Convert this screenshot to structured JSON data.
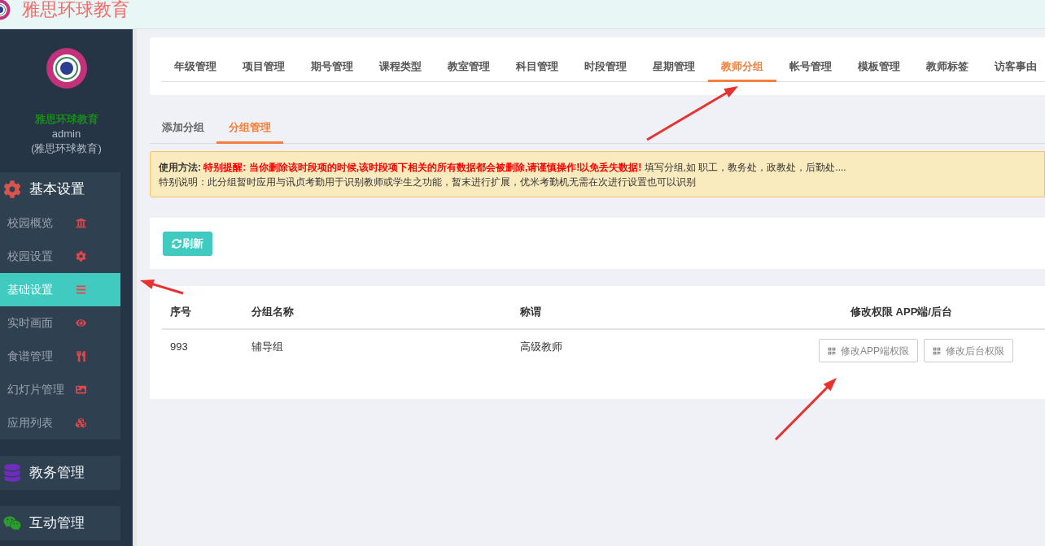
{
  "header": {
    "title": "雅思环球教育"
  },
  "sidebar": {
    "org_name": "雅思环球教育",
    "user": "admin",
    "user_org": "(雅思环球教育)",
    "groups": [
      {
        "label": "基本设置",
        "expanded": true,
        "items": [
          {
            "label": "校园概览",
            "selected": false
          },
          {
            "label": "校园设置",
            "selected": false
          },
          {
            "label": "基础设置",
            "selected": true
          },
          {
            "label": "实时画面",
            "selected": false
          },
          {
            "label": "食谱管理",
            "selected": false
          },
          {
            "label": "幻灯片管理",
            "selected": false
          },
          {
            "label": "应用列表",
            "selected": false
          }
        ]
      },
      {
        "label": "教务管理",
        "expanded": false
      },
      {
        "label": "互动管理",
        "expanded": false
      }
    ]
  },
  "top_tabs": [
    {
      "label": "年级管理",
      "selected": false
    },
    {
      "label": "项目管理",
      "selected": false
    },
    {
      "label": "期号管理",
      "selected": false
    },
    {
      "label": "课程类型",
      "selected": false
    },
    {
      "label": "教室管理",
      "selected": false
    },
    {
      "label": "科目管理",
      "selected": false
    },
    {
      "label": "时段管理",
      "selected": false
    },
    {
      "label": "星期管理",
      "selected": false
    },
    {
      "label": "教师分组",
      "selected": true
    },
    {
      "label": "帐号管理",
      "selected": false
    },
    {
      "label": "模板管理",
      "selected": false
    },
    {
      "label": "教师标签",
      "selected": false
    },
    {
      "label": "访客事由",
      "selected": false
    }
  ],
  "sub_tabs": [
    {
      "label": "添加分组",
      "selected": false
    },
    {
      "label": "分组管理",
      "selected": true
    }
  ],
  "notice": {
    "label": "使用方法:",
    "warning": "特别提醒: 当你删除该时段项的时候,该时段项下相关的所有数据都会被删除,请谨慎操作!以免丢失数据!",
    "hint": "填写分组,如 职工，教务处，政教处，后勤处....",
    "note": "特别说明：此分组暂时应用与讯贞考勤用于识别教师或学生之功能，暂末进行扩展，优米考勤机无需在次进行设置也可以识别"
  },
  "refresh_button": "刷新",
  "table": {
    "columns": [
      "序号",
      "分组名称",
      "称谓",
      "修改权限 APP端/后台"
    ],
    "rows": [
      {
        "id": "993",
        "name": "辅导组",
        "title": "高级教师",
        "actions": [
          "修改APP端权限",
          "修改后台权限"
        ]
      }
    ]
  }
}
